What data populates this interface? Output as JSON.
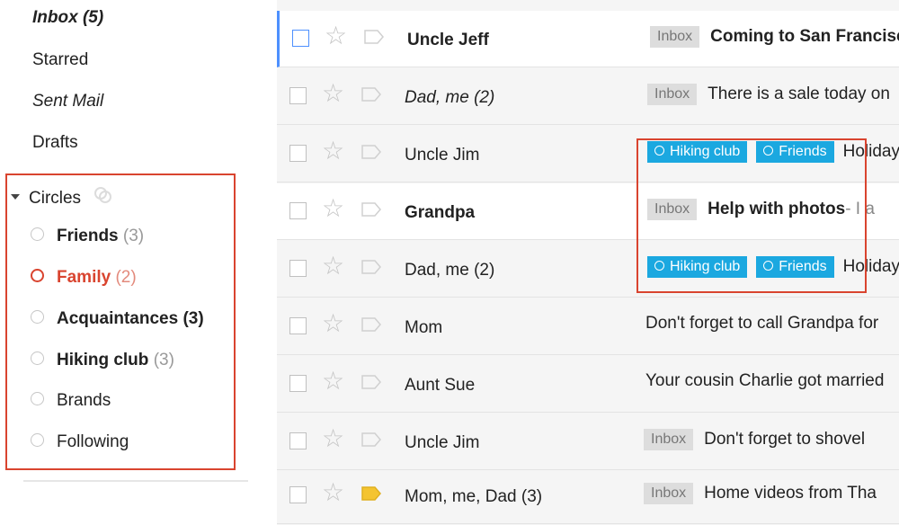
{
  "nav": {
    "inbox_label": "Inbox",
    "inbox_count": "(5)",
    "starred": "Starred",
    "sent": "Sent Mail",
    "drafts": "Drafts"
  },
  "circles": {
    "header": "Circles",
    "items": [
      {
        "name": "Friends",
        "count": "(3)"
      },
      {
        "name": "Family",
        "count": "(2)"
      },
      {
        "name": "Acquaintances",
        "count": "(3)"
      },
      {
        "name": "Hiking club",
        "count": "(3)"
      },
      {
        "name": "Brands",
        "count": ""
      },
      {
        "name": "Following",
        "count": ""
      }
    ]
  },
  "colors": {
    "highlight": "#d9442f",
    "circle_badge": "#1ba8e0",
    "selected_accent": "#4d90fe",
    "important_label": "#f4c430"
  },
  "rows": [
    {
      "sender": "Uncle Jeff",
      "badge": "Inbox",
      "subject": "Coming to San Francisco",
      "snippet": ""
    },
    {
      "sender": "Dad, me (2)",
      "badge": "Inbox",
      "subject": "",
      "snippet": "There is a sale today on"
    },
    {
      "sender": "Uncle Jim",
      "badges": [
        "Hiking club",
        "Friends"
      ],
      "snippet": "Holiday"
    },
    {
      "sender": "Grandpa",
      "badge": "Inbox",
      "subject": "Help with photos",
      "snippet": " - I a"
    },
    {
      "sender": "Dad, me (2)",
      "badges": [
        "Hiking club",
        "Friends"
      ],
      "snippet": "Holiday"
    },
    {
      "sender": "Mom",
      "snippet": "Don't forget to call Grandpa for"
    },
    {
      "sender": "Aunt Sue",
      "snippet": "Your cousin Charlie got married"
    },
    {
      "sender": "Uncle Jim",
      "badge": "Inbox",
      "snippet": "Don't forget to shovel"
    },
    {
      "sender": "Mom, me, Dad (3)",
      "badge": "Inbox",
      "snippet": "Home videos from Tha"
    }
  ]
}
